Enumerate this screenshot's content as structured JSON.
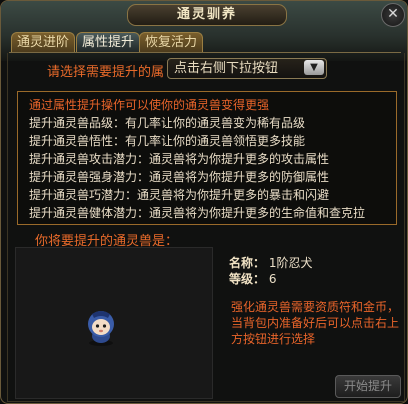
{
  "window": {
    "title": "通灵驯养",
    "close_glyph": "✕"
  },
  "tabs": [
    {
      "label": "通灵进阶",
      "active": false
    },
    {
      "label": "属性提升",
      "active": true
    },
    {
      "label": "恢复活力",
      "active": false
    }
  ],
  "selector": {
    "label": "请选择需要提升的属",
    "dropdown_value": "点击右侧下拉按钮",
    "arrow_icon": "chevron-down-icon"
  },
  "info": {
    "lines": [
      "通过属性提升操作可以使你的通灵兽变得更强",
      "提升通灵兽品级：有几率让你的通灵兽变为稀有品级",
      "提升通灵兽悟性：有几率让你的通灵兽领悟更多技能",
      "提升通灵兽攻击潜力：通灵兽将为你提升更多的攻击属性",
      "提升通灵兽强身潜力：通灵兽将为你提升更多的防御属性",
      "提升通灵兽巧潜力：通灵兽将为你提升更多的暴击和闪避",
      "提升通灵兽健体潜力：通灵兽将为你提升更多的生命值和查克拉"
    ]
  },
  "pet": {
    "prompt": "你将要提升的通灵兽是：",
    "name_label": "名称：",
    "name_value": "1阶忍犬",
    "level_label": "等级：",
    "level_value": "6"
  },
  "notice": {
    "lines": [
      "强化通灵兽需要资质符和金币，",
      "当背包内准备好后可以点击右上",
      "方按钮进行选择"
    ]
  },
  "actions": {
    "start_label": "开始提升"
  },
  "colors": {
    "accent_orange": "#e8642a",
    "border_gold": "#9a7e42"
  }
}
